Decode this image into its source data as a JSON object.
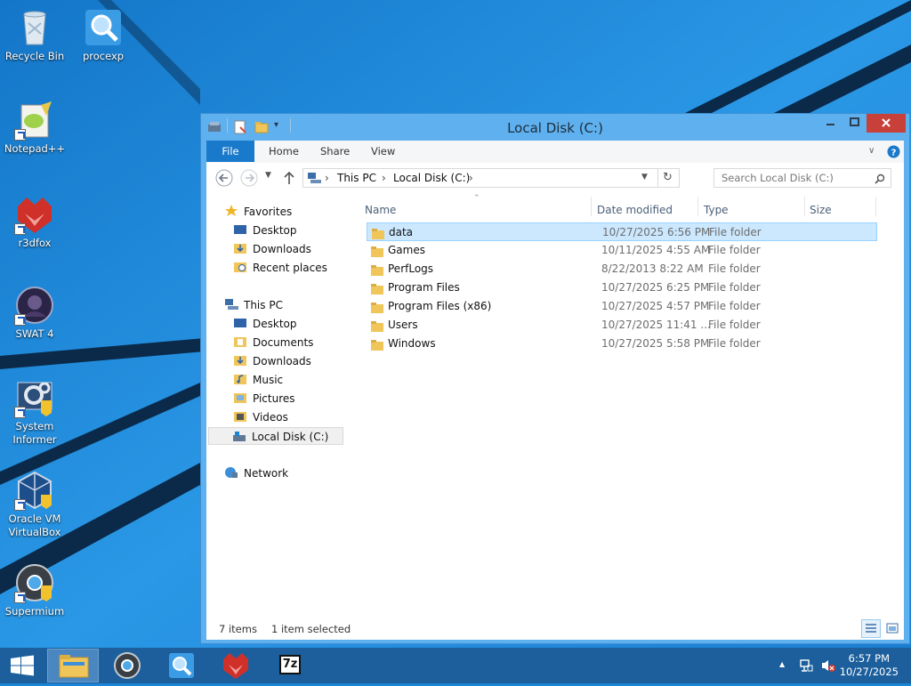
{
  "desktop": {
    "icons": [
      {
        "label": "Recycle Bin",
        "icon": "recycle-bin-icon"
      },
      {
        "label": "procexp",
        "icon": "procexp-icon"
      },
      {
        "label": "Notepad++",
        "icon": "notepad-plus-plus-icon"
      },
      {
        "label": "r3dfox",
        "icon": "r3dfox-icon"
      },
      {
        "label": "SWAT 4",
        "icon": "swat4-icon"
      },
      {
        "label": "System Informer",
        "icon": "system-informer-icon"
      },
      {
        "label": "Oracle VM VirtualBox",
        "icon": "virtualbox-icon"
      },
      {
        "label": "Supermium",
        "icon": "supermium-icon"
      }
    ]
  },
  "window": {
    "title": "Local Disk (C:)",
    "ribbon": {
      "file": "File",
      "home": "Home",
      "share": "Share",
      "view": "View"
    },
    "address": {
      "this_pc": "This PC",
      "local_disk": "Local Disk (C:)"
    },
    "search_placeholder": "Search Local Disk (C:)",
    "nav": {
      "favorites": "Favorites",
      "fav_items": [
        "Desktop",
        "Downloads",
        "Recent places"
      ],
      "this_pc": "This PC",
      "pc_items": [
        "Desktop",
        "Documents",
        "Downloads",
        "Music",
        "Pictures",
        "Videos",
        "Local Disk (C:)"
      ],
      "network": "Network"
    },
    "columns": {
      "name": "Name",
      "date": "Date modified",
      "type": "Type",
      "size": "Size"
    },
    "files": [
      {
        "name": "data",
        "date": "10/27/2025 6:56 PM",
        "type": "File folder"
      },
      {
        "name": "Games",
        "date": "10/11/2025 4:55 AM",
        "type": "File folder"
      },
      {
        "name": "PerfLogs",
        "date": "8/22/2013 8:22 AM",
        "type": "File folder"
      },
      {
        "name": "Program Files",
        "date": "10/27/2025 6:25 PM",
        "type": "File folder"
      },
      {
        "name": "Program Files (x86)",
        "date": "10/27/2025 4:57 PM",
        "type": "File folder"
      },
      {
        "name": "Users",
        "date": "10/27/2025 11:41 ...",
        "type": "File folder"
      },
      {
        "name": "Windows",
        "date": "10/27/2025 5:58 PM",
        "type": "File folder"
      }
    ],
    "status": {
      "items": "7 items",
      "selected": "1 item selected"
    }
  },
  "taskbar": {
    "apps": [
      "file-explorer-icon",
      "supermium-icon",
      "procexp-icon",
      "r3dfox-icon",
      "7zip-icon"
    ],
    "sevenzip_text": "7z",
    "time": "6:57 PM",
    "date": "10/27/2025"
  },
  "colors": {
    "desktop": "#1a84d6",
    "taskbar": "#1c5f9c",
    "window_frame": "#5fb0ee",
    "selection": "#cce8ff",
    "close": "#c7403a"
  }
}
